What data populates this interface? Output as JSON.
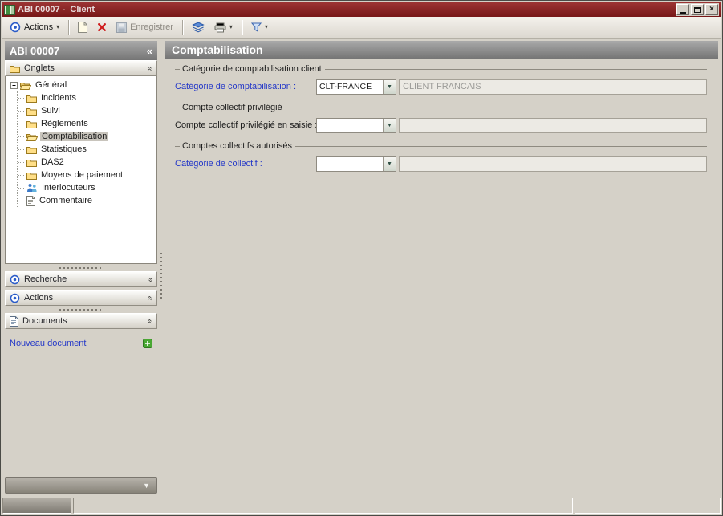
{
  "window": {
    "title": "ABI 00007 -  Client"
  },
  "icons": {
    "close": "×",
    "caret": "▾",
    "combo_arrow": "▼",
    "chevron": "»",
    "collapse": "«"
  },
  "toolbar": {
    "actions_label": "Actions",
    "save_label": "Enregistrer"
  },
  "sidebar": {
    "header_title": "ABI 00007",
    "panels": {
      "onglets": "Onglets",
      "recherche": "Recherche",
      "actions": "Actions",
      "documents": "Documents"
    },
    "tree": {
      "root_label": "Général",
      "items": [
        {
          "label": "Incidents"
        },
        {
          "label": "Suivi"
        },
        {
          "label": "Règlements"
        },
        {
          "label": "Comptabilisation",
          "selected": true
        },
        {
          "label": "Statistiques"
        },
        {
          "label": "DAS2"
        },
        {
          "label": "Moyens de paiement"
        },
        {
          "label": "Interlocuteurs"
        },
        {
          "label": "Commentaire"
        }
      ]
    },
    "new_document_label": "Nouveau document"
  },
  "main": {
    "title": "Comptabilisation",
    "groups": [
      {
        "legend": "Catégorie de comptabilisation client",
        "label": "Catégorie de comptabilisation :",
        "combo_value": "CLT-FRANCE",
        "field_value": "CLIENT FRANCAIS"
      },
      {
        "legend": "Compte collectif privilégié",
        "label": "Compte collectif privilégié en saisie :",
        "combo_value": "",
        "field_value": ""
      },
      {
        "legend": "Comptes collectifs autorisés",
        "label": "Catégorie de collectif :",
        "combo_value": "",
        "field_value": ""
      }
    ]
  }
}
